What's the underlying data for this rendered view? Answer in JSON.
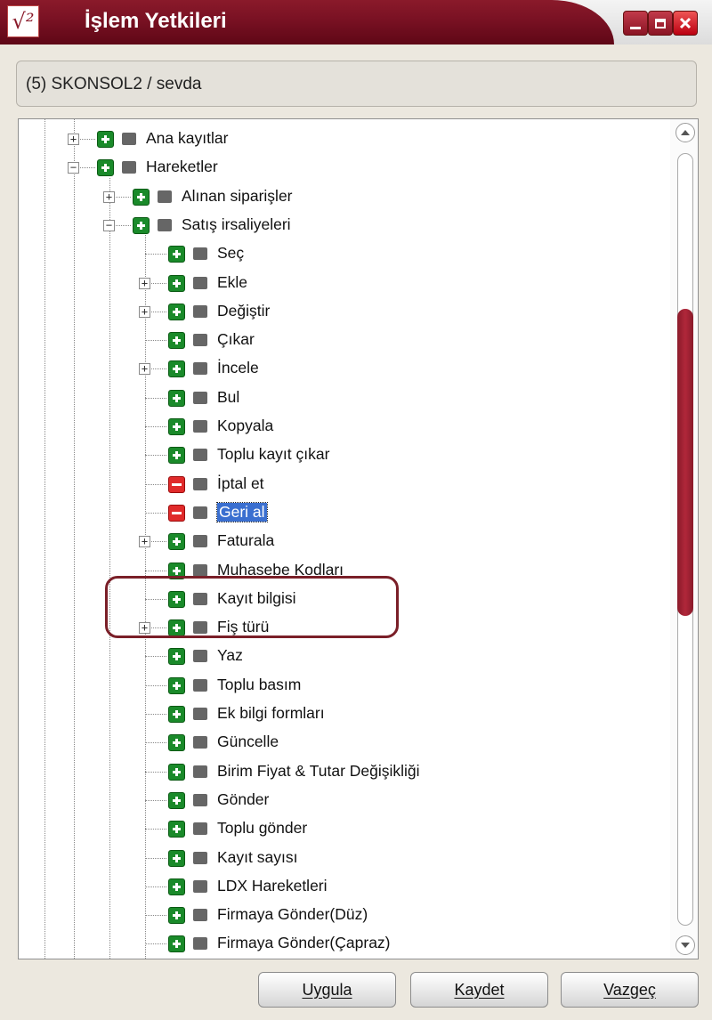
{
  "window": {
    "title": "İşlem Yetkileri",
    "logo_glyph": "√²"
  },
  "path": "(5) SKONSOL2 / sevda",
  "tree": [
    {
      "label": "Ana kayıtlar",
      "level": 0,
      "expander": "+",
      "perm": "grant"
    },
    {
      "label": "Hareketler",
      "level": 0,
      "expander": "−",
      "perm": "grant"
    },
    {
      "label": "Alınan siparişler",
      "level": 1,
      "expander": "+",
      "perm": "grant"
    },
    {
      "label": "Satış irsaliyeleri",
      "level": 1,
      "expander": "−",
      "perm": "grant"
    },
    {
      "label": "Seç",
      "level": 2,
      "expander": "",
      "perm": "grant"
    },
    {
      "label": "Ekle",
      "level": 2,
      "expander": "+",
      "perm": "grant"
    },
    {
      "label": "Değiştir",
      "level": 2,
      "expander": "+",
      "perm": "grant"
    },
    {
      "label": "Çıkar",
      "level": 2,
      "expander": "",
      "perm": "grant"
    },
    {
      "label": "İncele",
      "level": 2,
      "expander": "+",
      "perm": "grant"
    },
    {
      "label": "Bul",
      "level": 2,
      "expander": "",
      "perm": "grant"
    },
    {
      "label": "Kopyala",
      "level": 2,
      "expander": "",
      "perm": "grant"
    },
    {
      "label": "Toplu kayıt çıkar",
      "level": 2,
      "expander": "",
      "perm": "grant"
    },
    {
      "label": "İptal et",
      "level": 2,
      "expander": "",
      "perm": "deny"
    },
    {
      "label": "Geri al",
      "level": 2,
      "expander": "",
      "perm": "deny",
      "selected": true
    },
    {
      "label": "Faturala",
      "level": 2,
      "expander": "+",
      "perm": "grant"
    },
    {
      "label": "Muhasebe Kodları",
      "level": 2,
      "expander": "",
      "perm": "grant"
    },
    {
      "label": "Kayıt bilgisi",
      "level": 2,
      "expander": "",
      "perm": "grant"
    },
    {
      "label": "Fiş türü",
      "level": 2,
      "expander": "+",
      "perm": "grant"
    },
    {
      "label": "Yaz",
      "level": 2,
      "expander": "",
      "perm": "grant"
    },
    {
      "label": "Toplu basım",
      "level": 2,
      "expander": "",
      "perm": "grant"
    },
    {
      "label": "Ek bilgi formları",
      "level": 2,
      "expander": "",
      "perm": "grant"
    },
    {
      "label": "Güncelle",
      "level": 2,
      "expander": "",
      "perm": "grant"
    },
    {
      "label": "Birim Fiyat & Tutar Değişikliği",
      "level": 2,
      "expander": "",
      "perm": "grant"
    },
    {
      "label": "Gönder",
      "level": 2,
      "expander": "",
      "perm": "grant"
    },
    {
      "label": "Toplu gönder",
      "level": 2,
      "expander": "",
      "perm": "grant"
    },
    {
      "label": "Kayıt sayısı",
      "level": 2,
      "expander": "",
      "perm": "grant"
    },
    {
      "label": "LDX Hareketleri",
      "level": 2,
      "expander": "",
      "perm": "grant"
    },
    {
      "label": "Firmaya Gönder(Düz)",
      "level": 2,
      "expander": "",
      "perm": "grant"
    },
    {
      "label": "Firmaya Gönder(Çapraz)",
      "level": 2,
      "expander": "",
      "perm": "grant"
    }
  ],
  "buttons": {
    "apply": "Uygula",
    "save": "Kaydet",
    "cancel": "Vazgeç"
  },
  "colors": {
    "accent": "#7b1224",
    "grant": "#1a8a2a",
    "deny": "#e02a2a",
    "selection": "#3a6fd0"
  }
}
